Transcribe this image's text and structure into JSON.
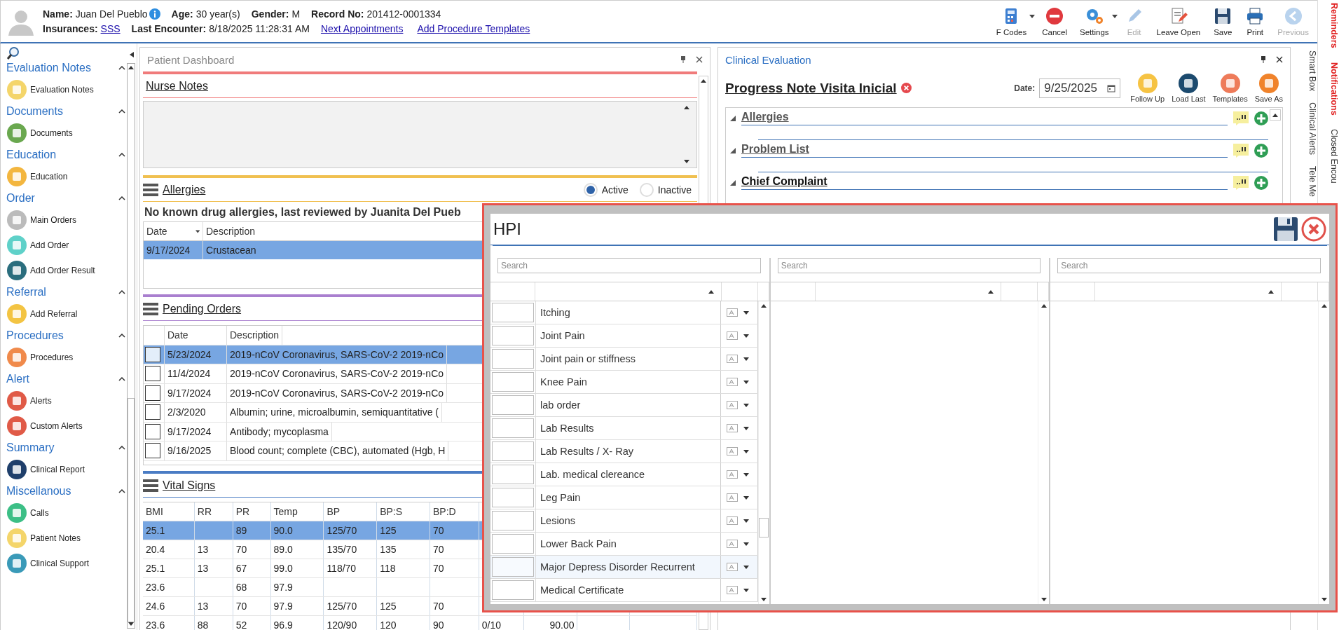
{
  "header": {
    "lines": [
      {
        "items": [
          {
            "kind": "field",
            "label": "Name:",
            "value": "Juan Del Pueblo",
            "link": false
          },
          {
            "kind": "info"
          },
          {
            "kind": "field",
            "label": "Age:",
            "value": "30 year(s)",
            "link": false
          },
          {
            "kind": "field",
            "label": "Gender:",
            "value": "M",
            "link": false
          },
          {
            "kind": "field",
            "label": "Record No:",
            "value": "201412-0001334",
            "link": false
          }
        ]
      },
      {
        "items": [
          {
            "kind": "field",
            "label": "Insurances:",
            "value": "SSS",
            "link": true
          },
          {
            "kind": "field",
            "label": "Last Encounter:",
            "value": "8/18/2025 11:28:31 AM",
            "link": false
          },
          {
            "kind": "link",
            "text": "Next Appointments"
          },
          {
            "kind": "link",
            "text": "Add Procedure Templates"
          }
        ]
      }
    ],
    "toolbar": [
      {
        "label": "F Codes",
        "dropdown": true,
        "disabled": false
      },
      {
        "label": "Cancel",
        "dropdown": false,
        "disabled": false
      },
      {
        "label": "Settings",
        "dropdown": true,
        "disabled": false
      },
      {
        "label": "Edit",
        "dropdown": false,
        "disabled": true
      },
      {
        "label": "Leave Open",
        "dropdown": false,
        "disabled": false
      },
      {
        "label": "Save",
        "dropdown": false,
        "disabled": false
      },
      {
        "label": "Print",
        "dropdown": false,
        "disabled": false
      },
      {
        "label": "Previous",
        "dropdown": false,
        "disabled": true
      }
    ]
  },
  "sidebar": {
    "groups": [
      {
        "title": "Evaluation Notes",
        "expanded": true,
        "items": [
          "Evaluation Notes"
        ]
      },
      {
        "title": "Documents",
        "expanded": true,
        "items": [
          "Documents"
        ]
      },
      {
        "title": "Education",
        "expanded": true,
        "items": [
          "Education"
        ]
      },
      {
        "title": "Order",
        "expanded": true,
        "items": [
          "Main Orders",
          "Add Order",
          "Add Order Result"
        ]
      },
      {
        "title": "Referral",
        "expanded": true,
        "items": [
          "Add Referral"
        ]
      },
      {
        "title": "Procedures",
        "expanded": true,
        "items": [
          "Procedures"
        ]
      },
      {
        "title": "Alert",
        "expanded": true,
        "items": [
          "Alerts",
          "Custom Alerts"
        ]
      },
      {
        "title": "Summary",
        "expanded": true,
        "items": [
          "Clinical Report"
        ]
      },
      {
        "title": "Miscellanous",
        "expanded": true,
        "items": [
          "Calls",
          "Patient Notes",
          "Clinical Support"
        ]
      }
    ]
  },
  "dashboard": {
    "title": "Patient Dashboard",
    "sections": [
      {
        "kind": "notes",
        "title": "Nurse Notes",
        "color": "#f07b7b"
      },
      {
        "kind": "allergies",
        "title": "Allergies",
        "color": "#f0c050",
        "filters": [
          {
            "label": "Active",
            "selected": true
          },
          {
            "label": "Inactive",
            "selected": false
          }
        ],
        "summary": "No known drug allergies, last reviewed by Juanita Del Pueb",
        "columns": [
          "Date",
          "Description"
        ],
        "rows": [
          {
            "cells": [
              "9/17/2024",
              "Crustacean"
            ],
            "selected": true
          }
        ]
      },
      {
        "kind": "orders",
        "title": "Pending Orders",
        "color": "#a97fcf",
        "columns": [
          "Date",
          "Description"
        ],
        "rows": [
          {
            "cells": [
              "5/23/2024",
              "2019-nCoV Coronavirus, SARS-CoV-2 2019-nCo"
            ],
            "selected": true,
            "checked": false
          },
          {
            "cells": [
              "11/4/2024",
              "2019-nCoV Coronavirus, SARS-CoV-2 2019-nCo"
            ],
            "selected": false,
            "checked": false
          },
          {
            "cells": [
              "9/17/2024",
              "2019-nCoV Coronavirus, SARS-CoV-2 2019-nCo"
            ],
            "selected": false,
            "checked": false
          },
          {
            "cells": [
              "2/3/2020",
              "Albumin; urine, microalbumin, semiquantitative ("
            ],
            "selected": false,
            "checked": false
          },
          {
            "cells": [
              "9/17/2024",
              "Antibody; mycoplasma"
            ],
            "selected": false,
            "checked": false
          },
          {
            "cells": [
              "9/16/2025",
              "Blood count; complete (CBC), automated (Hgb, H"
            ],
            "selected": false,
            "checked": false
          }
        ]
      },
      {
        "kind": "vitals",
        "title": "Vital Signs",
        "color": "#4a7cc4",
        "columns": [
          "BMI",
          "RR",
          "PR",
          "Temp",
          "BP",
          "BP:S",
          "BP:D"
        ],
        "rows": [
          {
            "cells": [
              "25.1",
              "",
              "89",
              "90.0",
              "125/70",
              "125",
              "70"
            ],
            "selected": true
          },
          {
            "cells": [
              "20.4",
              "13",
              "70",
              "89.0",
              "135/70",
              "135",
              "70"
            ],
            "selected": false
          },
          {
            "cells": [
              "25.1",
              "13",
              "67",
              "99.0",
              "118/70",
              "118",
              "70"
            ],
            "selected": false
          },
          {
            "cells": [
              "23.6",
              "",
              "68",
              "97.9",
              "",
              "",
              ""
            ],
            "selected": false
          },
          {
            "cells": [
              "24.6",
              "13",
              "70",
              "97.9",
              "125/70",
              "125",
              "70"
            ],
            "selected": false
          },
          {
            "cells": [
              "23.6",
              "88",
              "52",
              "96.9",
              "120/90",
              "120",
              "90",
              "0/10",
              "90.00"
            ],
            "selected": false
          }
        ]
      }
    ]
  },
  "clinical": {
    "title": "Clinical Evaluation",
    "note_title": "Progress Note Visita Inicial",
    "date_label": "Date:",
    "date": "9/25/2025",
    "actions": [
      "Follow Up",
      "Load Last",
      "Templates",
      "Save As"
    ],
    "sections": [
      {
        "title": "Allergies",
        "expanded": true,
        "highlighted": false
      },
      {
        "title": "Problem List",
        "expanded": true,
        "highlighted": false
      },
      {
        "title": "Chief Complaint",
        "expanded": true,
        "highlighted": true
      }
    ]
  },
  "side_tabs": [
    {
      "label": "Smart Box",
      "alert": false
    },
    {
      "label": "Clinical Alerts",
      "alert": false
    },
    {
      "label": "Tele Me",
      "alert": false
    }
  ],
  "far_tabs": [
    {
      "label": "Reminders",
      "alert": true
    },
    {
      "label": "Notifications",
      "alert": true
    },
    {
      "label": "Closed Encou",
      "alert": false
    }
  ],
  "hpi": {
    "title": "HPI",
    "panes": [
      {
        "placeholder": "Search",
        "items": [
          {
            "label": "Itching",
            "hovered": false
          },
          {
            "label": "Joint Pain",
            "hovered": false
          },
          {
            "label": "Joint pain or stiffness",
            "hovered": false
          },
          {
            "label": "Knee Pain",
            "hovered": false
          },
          {
            "label": "lab order",
            "hovered": false
          },
          {
            "label": "Lab Results",
            "hovered": false
          },
          {
            "label": "Lab Results / X- Ray",
            "hovered": false
          },
          {
            "label": "Lab. medical clereance",
            "hovered": false
          },
          {
            "label": "Leg Pain",
            "hovered": false
          },
          {
            "label": "Lesions",
            "hovered": false
          },
          {
            "label": "Lower Back Pain",
            "hovered": false
          },
          {
            "label": "Major Depress Disorder Recurrent",
            "hovered": true
          },
          {
            "label": "Medical Certificate",
            "hovered": false
          }
        ]
      },
      {
        "placeholder": "Search"
      },
      {
        "placeholder": "Search"
      }
    ]
  }
}
